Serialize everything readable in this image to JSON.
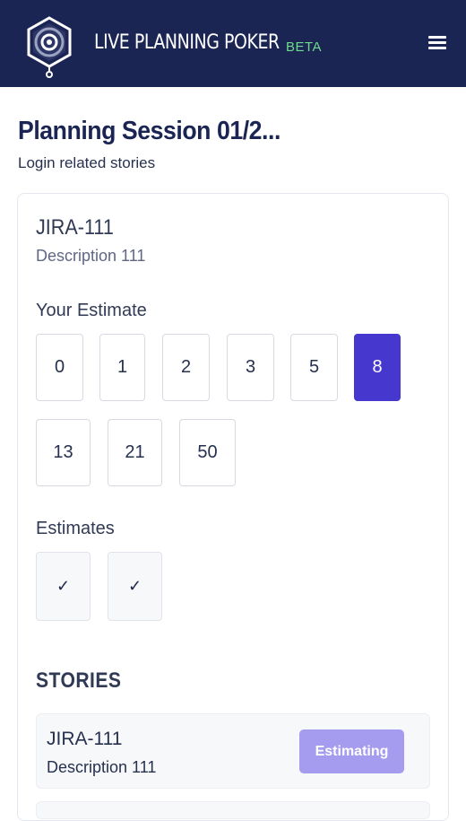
{
  "header": {
    "app_title": "LIVE PLANNING POKER",
    "badge": "BETA",
    "logo_icon": "target-hexagon-icon",
    "menu_icon": "hamburger-menu-icon",
    "background_color": "#1b2554"
  },
  "session": {
    "title": "Planning Session 01/2...",
    "subtitle": "Login related stories"
  },
  "current_story": {
    "key": "JIRA-111",
    "description": "Description 111"
  },
  "estimate": {
    "label": "Your Estimate",
    "cards": [
      "0",
      "1",
      "2",
      "3",
      "5",
      "8",
      "13",
      "21",
      "50"
    ],
    "selected": "8",
    "selected_color": "#4638cf"
  },
  "estimates": {
    "label": "Estimates",
    "cards": [
      "✓",
      "✓"
    ]
  },
  "stories": {
    "heading": "STORIES",
    "items": [
      {
        "key": "JIRA-111",
        "description": "Description 111",
        "status": "Estimating"
      }
    ]
  }
}
